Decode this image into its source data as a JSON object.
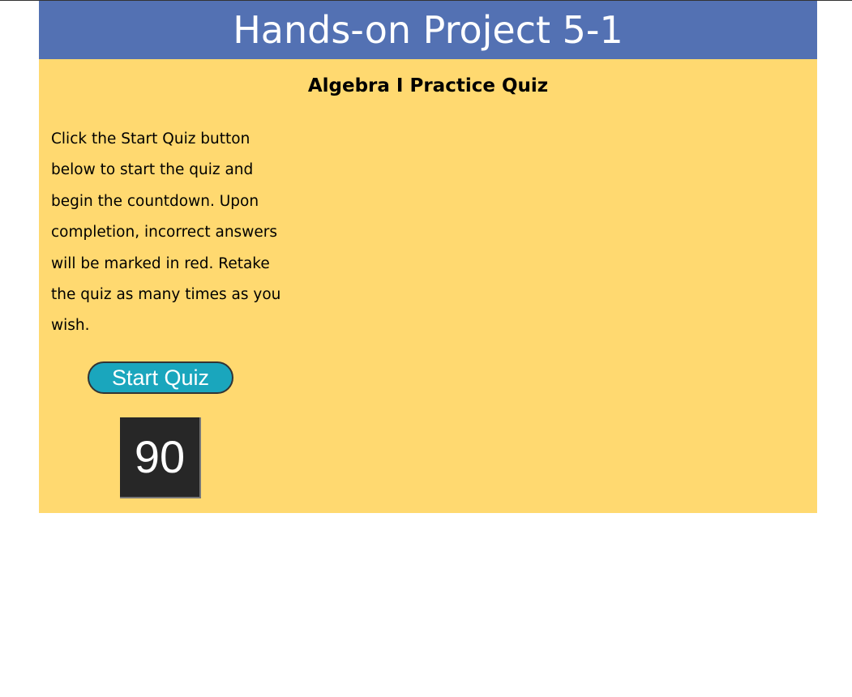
{
  "header": {
    "title": "Hands-on Project 5-1"
  },
  "quiz": {
    "title": "Algebra I Practice Quiz",
    "instructions": "Click the Start Quiz button below to start the quiz and begin the countdown. Upon completion, incorrect answers will be marked in red. Retake the quiz as many times as you wish.",
    "start_button_label": "Start Quiz",
    "timer_value": "90"
  },
  "colors": {
    "banner": "#5371b3",
    "page_background": "#ffd970",
    "button": "#1aa6bd",
    "timer_background": "#272727"
  }
}
